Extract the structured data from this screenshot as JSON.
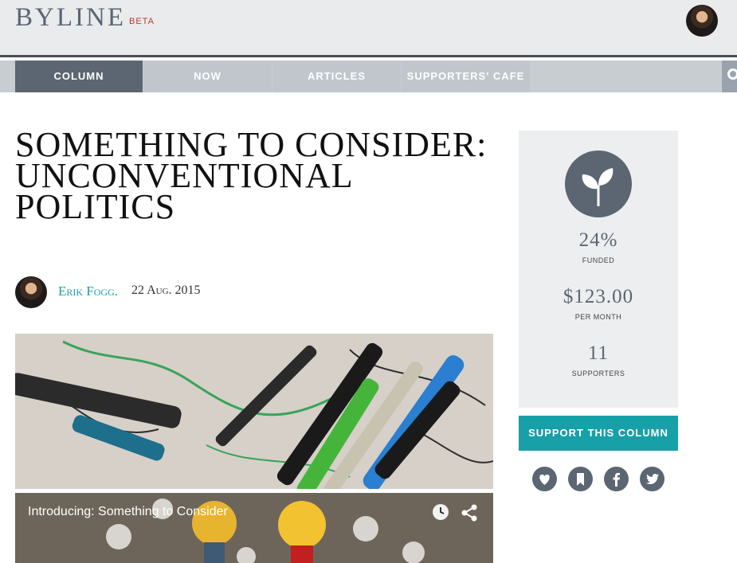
{
  "header": {
    "logo": "BYLINE",
    "badge": "BETA"
  },
  "nav": {
    "tabs": [
      {
        "label": "COLUMN"
      },
      {
        "label": "NOW"
      },
      {
        "label": "ARTICLES"
      },
      {
        "label": "SUPPORTERS' CAFE"
      }
    ]
  },
  "article": {
    "title": "SOMETHING TO CONSIDER: UNCONVENTIONAL POLITICS",
    "author": "Erik Fogg",
    "author_suffix": ".",
    "date": "22 Aug. 2015"
  },
  "video": {
    "title": "Introducing: Something to Consider"
  },
  "sidebar": {
    "funded_value": "24%",
    "funded_label": "FUNDED",
    "monthly_value": "$123.00",
    "monthly_label": "PER MONTH",
    "supporters_value": "11",
    "supporters_label": "SUPPORTERS",
    "support_button": "SUPPORT THIS COLUMN",
    "social_icons": [
      "heart-icon",
      "bookmark-icon",
      "facebook-icon",
      "twitter-icon"
    ]
  },
  "colors": {
    "accent": "#17a0a7",
    "slate": "#5b6672",
    "badge": "#c0392b"
  }
}
